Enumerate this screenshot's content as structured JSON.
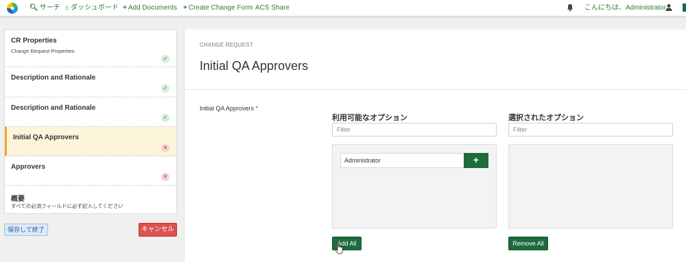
{
  "nav": {
    "search": "サーチ",
    "dashboard": "ダッシュボード",
    "add_documents": "Add Documents",
    "create_change_form": "Create Change Form",
    "acs_share": "ACS Share",
    "greeting": "こんにちは、Administrator"
  },
  "icons": {
    "search": "search-icon",
    "home": "home-icon",
    "plus": "plus-icon",
    "bell": "bell-icon",
    "user": "user-icon",
    "check": "check-icon",
    "cross": "cross-icon"
  },
  "steps": [
    {
      "title": "CR Properties",
      "subtitle": "Change Request Properties",
      "status": "complete"
    },
    {
      "title": "Description and Rationale",
      "subtitle": "",
      "status": "complete"
    },
    {
      "title": "Description and Rationale",
      "subtitle": "",
      "status": "complete"
    },
    {
      "title": "Initial QA Approvers",
      "subtitle": "",
      "status": "incomplete",
      "active": true
    },
    {
      "title": "Approvers",
      "subtitle": "",
      "status": "incomplete"
    },
    {
      "title": "概要",
      "subtitle": "すべての必須フィールドに必ず記入してください",
      "status": ""
    }
  ],
  "actions": {
    "save_exit": "保存して終了",
    "cancel": "キャンセル"
  },
  "form": {
    "breadcrumb": "CHANGE REQUEST",
    "title": "Initial QA Approvers",
    "field_label": "Initial QA Approvers",
    "required_mark": "*"
  },
  "picker": {
    "available_heading": "利用可能なオプション",
    "selected_heading": "選択されたオプション",
    "filter_placeholder": "Filter",
    "available_options": [
      "Administrator"
    ],
    "selected_options": [],
    "add_all": "Add All",
    "remove_all": "Remove All"
  },
  "colors": {
    "brand_green": "#1e6b3d",
    "nav_green": "#2e7d32",
    "active_step_bg": "#fdf4dc",
    "active_step_accent": "#f0a830",
    "cancel_red": "#d9534f"
  }
}
